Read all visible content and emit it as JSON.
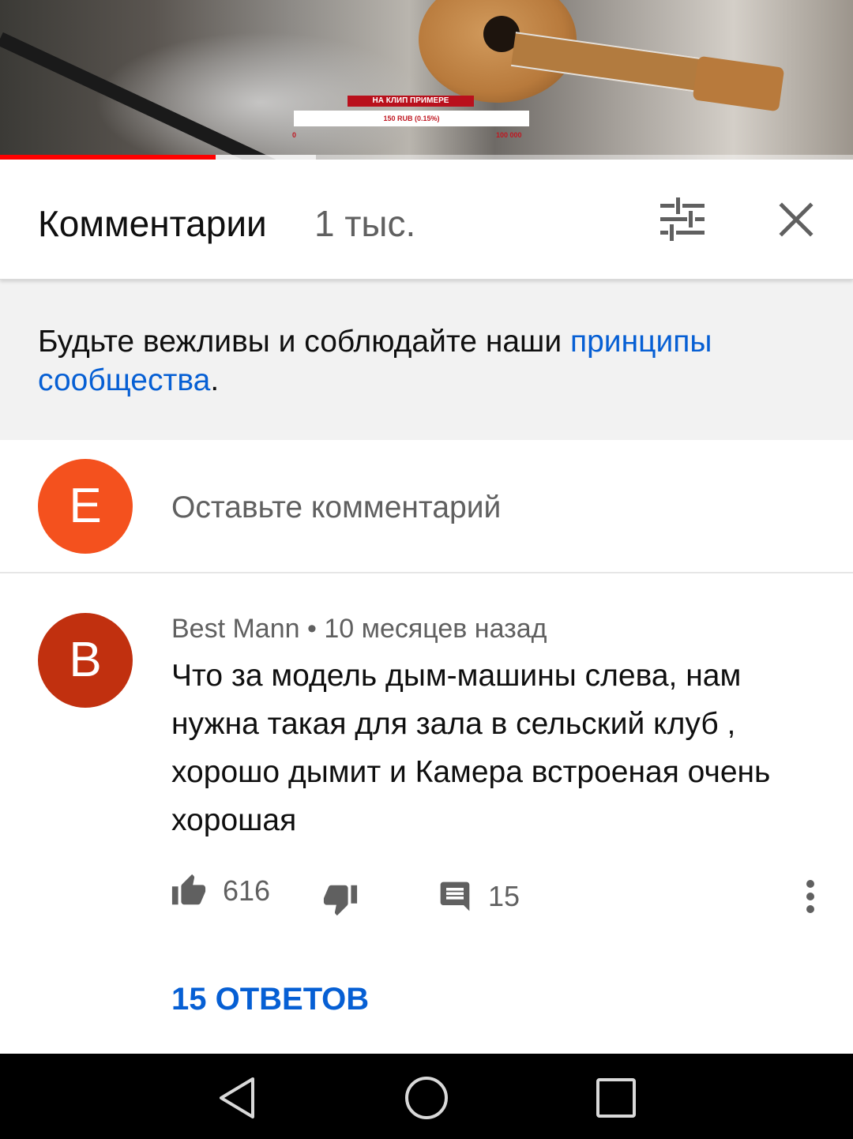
{
  "video": {
    "overlay_title": "НА КЛИП ПРИМЕРЕ",
    "overlay_amount": "150 RUB (0.15%)",
    "overlay_min": "0",
    "overlay_max": "100 000",
    "progress_played": 0.253,
    "progress_buffered": 0.37,
    "colors": {
      "played": "#ff0000"
    }
  },
  "comments_header": {
    "title": "Комментарии",
    "count": "1 тыс.",
    "sort_icon": "sort-sliders-icon",
    "close_icon": "close-icon"
  },
  "guidelines": {
    "text": "Будьте вежливы и соблюдайте наши ",
    "link": "принципы сообщества",
    "suffix": "."
  },
  "add_comment": {
    "avatar_letter": "E",
    "avatar_color": "#f4511e",
    "placeholder": "Оставьте комментарий"
  },
  "comment": {
    "avatar_letter": "B",
    "avatar_color": "#c1300f",
    "meta": "Best Mann • 10 месяцев назад",
    "text": "Что за модель дым-машины слева, нам нужна такая для зала в сельский клуб , хорошо дымит и Камера встроеная очень хорошая",
    "likes": "616",
    "reply_count": "15",
    "view_replies": "15 ОТВЕТОВ"
  },
  "navbar": {
    "back_icon": "back-triangle-icon",
    "home_icon": "home-circle-icon",
    "recents_icon": "recents-square-icon"
  },
  "colors": {
    "link": "#065fd4",
    "secondary_text": "#606060",
    "banner_bg": "#f2f2f2"
  }
}
